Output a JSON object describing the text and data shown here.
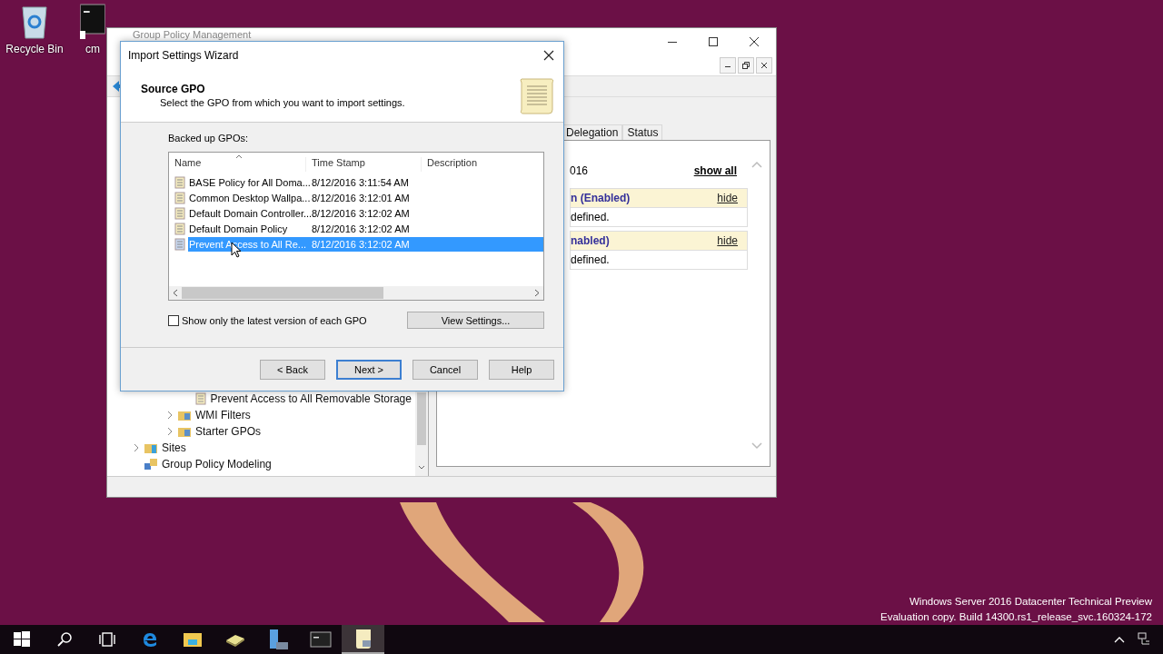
{
  "desktop_icons": [
    {
      "label": "Recycle Bin",
      "kind": "recycle-bin"
    },
    {
      "label": "cm",
      "kind": "console"
    }
  ],
  "background_window": {
    "title": "Group Policy Management",
    "tree": [
      {
        "children": [
          {
            "children": [
              {
                "children": [
                  {
                    "label": "Prevent Access to All Removable Storage",
                    "kind": "gpo",
                    "has_children": false
                  }
                ]
              },
              {
                "label": "WMI Filters",
                "kind": "folder",
                "has_children": true
              },
              {
                "label": "Starter GPOs",
                "kind": "folder",
                "has_children": true
              }
            ]
          }
        ]
      },
      {
        "label": "Sites",
        "kind": "sites",
        "has_children": true
      },
      {
        "label": "Group Policy Modeling",
        "kind": "modeling",
        "has_children": false
      }
    ],
    "tabs": [
      {
        "label": "Delegation",
        "selected": false
      },
      {
        "label": "Status",
        "selected": false
      }
    ],
    "report": {
      "date": "016",
      "show_all": "show all",
      "sections": [
        {
          "heading": "n (Enabled)",
          "action": "hide",
          "body": "defined."
        },
        {
          "heading": "nabled)",
          "action": "hide",
          "body": "defined."
        }
      ]
    }
  },
  "wizard": {
    "title": "Import Settings Wizard",
    "heading": "Source GPO",
    "subtitle": "Select the GPO from which you want to import settings.",
    "list_label": "Backed up GPOs:",
    "columns": [
      "Name",
      "Time Stamp",
      "Description"
    ],
    "rows": [
      {
        "name": "BASE Policy for All Doma...",
        "time_stamp": "8/12/2016 3:11:54 AM",
        "selected": false
      },
      {
        "name": "Common Desktop Wallpa...",
        "time_stamp": "8/12/2016 3:12:01 AM",
        "selected": false
      },
      {
        "name": "Default Domain Controller...",
        "time_stamp": "8/12/2016 3:12:02 AM",
        "selected": false
      },
      {
        "name": "Default Domain Policy",
        "time_stamp": "8/12/2016 3:12:02 AM",
        "selected": false
      },
      {
        "name": "Prevent Access to All Re...",
        "time_stamp": "8/12/2016 3:12:02 AM",
        "selected": true
      }
    ],
    "latest_only": {
      "label": "Show only the latest version of each GPO",
      "checked": false
    },
    "view_settings": "View Settings...",
    "buttons": [
      {
        "label": "< Back",
        "default": false
      },
      {
        "label": "Next >",
        "default": true
      },
      {
        "label": "Cancel",
        "default": false
      },
      {
        "label": "Help",
        "default": false
      }
    ]
  },
  "build_info": [
    "Windows Server 2016 Datacenter Technical Preview",
    "Evaluation copy. Build 14300.rs1_release_svc.160324-172"
  ],
  "taskbar": {
    "items": [
      {
        "kind": "start",
        "selected": false
      },
      {
        "kind": "search",
        "selected": false
      },
      {
        "kind": "task-view",
        "selected": false
      },
      {
        "kind": "browser",
        "selected": false
      },
      {
        "kind": "folder",
        "selected": false
      },
      {
        "kind": "tray",
        "selected": false
      },
      {
        "kind": "server",
        "selected": false
      },
      {
        "kind": "console",
        "selected": false
      },
      {
        "kind": "scroll",
        "selected": true
      }
    ]
  }
}
